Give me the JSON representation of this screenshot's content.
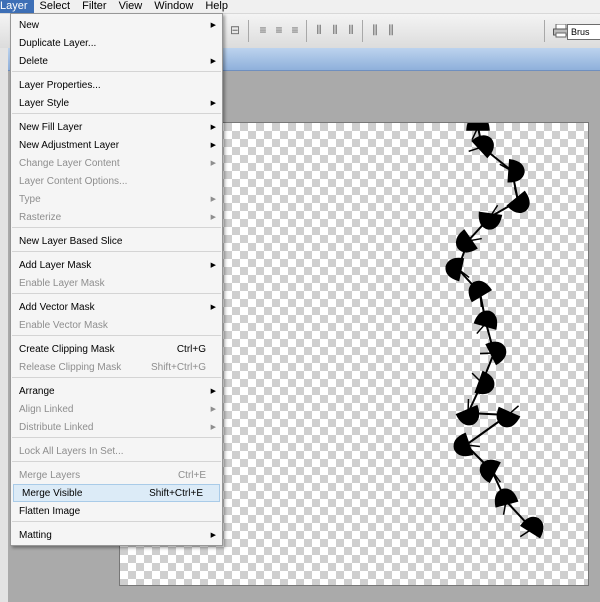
{
  "menubar": {
    "items": [
      "Layer",
      "Select",
      "Filter",
      "View",
      "Window",
      "Help"
    ],
    "active_index": 0
  },
  "toolbar": {
    "brush_label": "Brus"
  },
  "layer_menu": {
    "items": [
      {
        "label": "New",
        "shortcut": "",
        "submenu": true,
        "disabled": false
      },
      {
        "label": "Duplicate Layer...",
        "shortcut": "",
        "submenu": false,
        "disabled": false
      },
      {
        "label": "Delete",
        "shortcut": "",
        "submenu": true,
        "disabled": false
      },
      {
        "label": "Layer Properties...",
        "shortcut": "",
        "submenu": false,
        "disabled": false
      },
      {
        "label": "Layer Style",
        "shortcut": "",
        "submenu": true,
        "disabled": false
      },
      {
        "label": "New Fill Layer",
        "shortcut": "",
        "submenu": true,
        "disabled": false
      },
      {
        "label": "New Adjustment Layer",
        "shortcut": "",
        "submenu": true,
        "disabled": false
      },
      {
        "label": "Change Layer Content",
        "shortcut": "",
        "submenu": true,
        "disabled": true
      },
      {
        "label": "Layer Content Options...",
        "shortcut": "",
        "submenu": false,
        "disabled": true
      },
      {
        "label": "Type",
        "shortcut": "",
        "submenu": true,
        "disabled": true
      },
      {
        "label": "Rasterize",
        "shortcut": "",
        "submenu": true,
        "disabled": true
      },
      {
        "label": "New Layer Based Slice",
        "shortcut": "",
        "submenu": false,
        "disabled": false
      },
      {
        "label": "Add Layer Mask",
        "shortcut": "",
        "submenu": true,
        "disabled": false
      },
      {
        "label": "Enable Layer Mask",
        "shortcut": "",
        "submenu": false,
        "disabled": true
      },
      {
        "label": "Add Vector Mask",
        "shortcut": "",
        "submenu": true,
        "disabled": false
      },
      {
        "label": "Enable Vector Mask",
        "shortcut": "",
        "submenu": false,
        "disabled": true
      },
      {
        "label": "Create Clipping Mask",
        "shortcut": "Ctrl+G",
        "submenu": false,
        "disabled": false
      },
      {
        "label": "Release Clipping Mask",
        "shortcut": "Shift+Ctrl+G",
        "submenu": false,
        "disabled": true
      },
      {
        "label": "Arrange",
        "shortcut": "",
        "submenu": true,
        "disabled": false
      },
      {
        "label": "Align Linked",
        "shortcut": "",
        "submenu": true,
        "disabled": true
      },
      {
        "label": "Distribute Linked",
        "shortcut": "",
        "submenu": true,
        "disabled": true
      },
      {
        "label": "Lock All Layers In Set...",
        "shortcut": "",
        "submenu": false,
        "disabled": true
      },
      {
        "label": "Merge Layers",
        "shortcut": "Ctrl+E",
        "submenu": false,
        "disabled": true
      },
      {
        "label": "Merge Visible",
        "shortcut": "Shift+Ctrl+E",
        "submenu": false,
        "disabled": false,
        "highlighted": true
      },
      {
        "label": "Flatten Image",
        "shortcut": "",
        "submenu": false,
        "disabled": false
      },
      {
        "label": "Matting",
        "shortcut": "",
        "submenu": true,
        "disabled": false
      }
    ]
  },
  "colors": {
    "menubar_active": "#3d6fb6",
    "menu_highlight": "#dcebf7",
    "disabled_text": "#8e8e8e"
  },
  "icons": {
    "submenu_arrow": "triangle-right-icon",
    "printer": "printer-icon"
  }
}
